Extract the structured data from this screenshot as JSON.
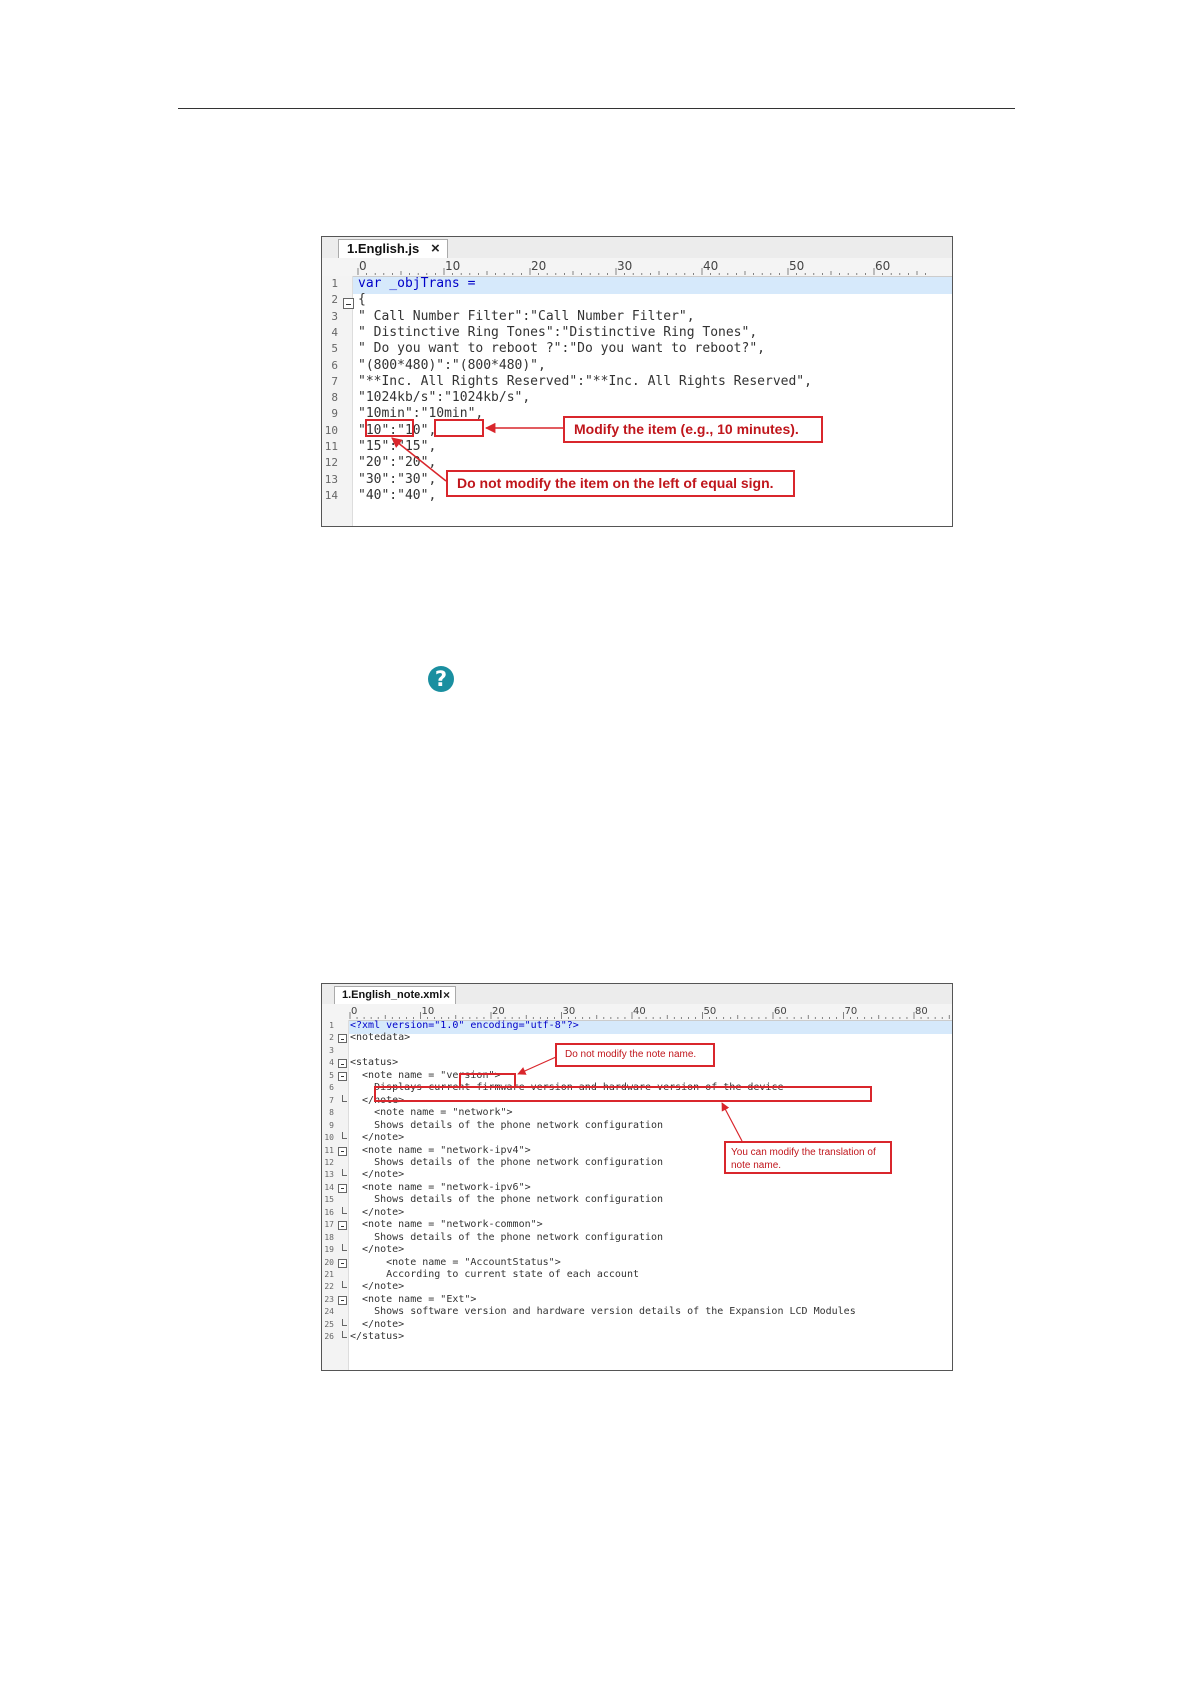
{
  "shot1": {
    "tab_label": "1.English.js",
    "tab_close": "×",
    "ruler_labels": [
      "0",
      "10",
      "20",
      "30",
      "40",
      "50",
      "60"
    ],
    "lines": [
      {
        "n": "1",
        "text": "var _objTrans ="
      },
      {
        "n": "2",
        "text": "{"
      },
      {
        "n": "3",
        "text": "\" Call Number Filter\":\"Call Number Filter\","
      },
      {
        "n": "4",
        "text": "\" Distinctive Ring Tones\":\"Distinctive Ring Tones\","
      },
      {
        "n": "5",
        "text": "\" Do you want to reboot ?\":\"Do you want to reboot?\","
      },
      {
        "n": "6",
        "text": "\"(800*480)\":\"(800*480)\","
      },
      {
        "n": "7",
        "text": "\"**Inc. All Rights Reserved\":\"**Inc. All Rights Reserved\","
      },
      {
        "n": "8",
        "text": "\"1024kb/s\":\"1024kb/s\","
      },
      {
        "n": "9",
        "text": "\"10min\":\"10min\","
      },
      {
        "n": "10",
        "text": "\"10\":\"10\","
      },
      {
        "n": "11",
        "text": "\"15\":\"15\","
      },
      {
        "n": "12",
        "text": "\"20\":\"20\","
      },
      {
        "n": "13",
        "text": "\"30\":\"30\","
      },
      {
        "n": "14",
        "text": "\"40\":\"40\","
      }
    ],
    "callout_modify": "Modify the item (e.g., 10 minutes).",
    "callout_left": "Do not modify the item on the left of equal sign."
  },
  "help_icon": "?",
  "shot2": {
    "tab_label": "1.English_note.xml",
    "tab_close": "×",
    "ruler_labels": [
      "0",
      "10",
      "20",
      "30",
      "40",
      "50",
      "60",
      "70",
      "80"
    ],
    "lines": [
      {
        "n": "1",
        "text": "<?xml version=\"1.0\" encoding=\"utf-8\"?>"
      },
      {
        "n": "2",
        "text": "<notedata>"
      },
      {
        "n": "3",
        "text": ""
      },
      {
        "n": "4",
        "text": "<status>"
      },
      {
        "n": "5",
        "text": "  <note name = \"version\">"
      },
      {
        "n": "6",
        "text": "    Displays current firmware version and hardware version of the device"
      },
      {
        "n": "7",
        "text": "  </note>"
      },
      {
        "n": "8",
        "text": "    <note name = \"network\">"
      },
      {
        "n": "9",
        "text": "    Shows details of the phone network configuration"
      },
      {
        "n": "10",
        "text": "  </note>"
      },
      {
        "n": "11",
        "text": "  <note name = \"network-ipv4\">"
      },
      {
        "n": "12",
        "text": "    Shows details of the phone network configuration"
      },
      {
        "n": "13",
        "text": "  </note>"
      },
      {
        "n": "14",
        "text": "  <note name = \"network-ipv6\">"
      },
      {
        "n": "15",
        "text": "    Shows details of the phone network configuration"
      },
      {
        "n": "16",
        "text": "  </note>"
      },
      {
        "n": "17",
        "text": "  <note name = \"network-common\">"
      },
      {
        "n": "18",
        "text": "    Shows details of the phone network configuration"
      },
      {
        "n": "19",
        "text": "  </note>"
      },
      {
        "n": "20",
        "text": "      <note name = \"AccountStatus\">"
      },
      {
        "n": "21",
        "text": "      According to current state of each account"
      },
      {
        "n": "22",
        "text": "  </note>"
      },
      {
        "n": "23",
        "text": "  <note name = \"Ext\">"
      },
      {
        "n": "24",
        "text": "    Shows software version and hardware version details of the Expansion LCD Modules"
      },
      {
        "n": "25",
        "text": "  </note>"
      },
      {
        "n": "26",
        "text": "</status>"
      }
    ],
    "callout_name": "Do not modify the note name.",
    "callout_translation_1": "You can modify the translation of",
    "callout_translation_2": "note name."
  }
}
